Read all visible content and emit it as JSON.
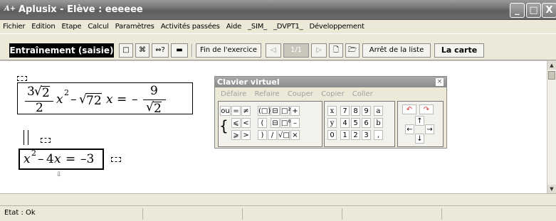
{
  "window": {
    "icon_text": "A+",
    "title": "Aplusix - Elève : eeeeee",
    "controls": {
      "minimize": "_",
      "maximize": "□",
      "close": "X"
    }
  },
  "menu": {
    "items": [
      "Fichier",
      "Edition",
      "Etape",
      "Calcul",
      "Paramètres",
      "Activités passées",
      "Aide",
      "_SIM_",
      "_DVPT1_",
      "Développement"
    ]
  },
  "toolbar": {
    "mode_label": "Entraînement (saisie)",
    "end_exercise": "Fin de l'exercice",
    "page_indicator": "1/1",
    "stop_list": "Arrêt de la liste",
    "card_label": "La carte",
    "icons": {
      "rect": "□",
      "grid": "⌘",
      "equiv": "⇔?",
      "keyboard": "▬",
      "prev": "◁",
      "next": "▷",
      "new": "🗋",
      "open": "🗁"
    }
  },
  "equation1": {
    "frac_num_coef": "3",
    "frac_num_rad": "2",
    "frac_den": "2",
    "x": "x",
    "sq": "2",
    "minus": "–",
    "rad2": "72",
    "x2": "x",
    "eq": "=",
    "neg": "–",
    "rhs_num": "9",
    "rhs_den_rad": "2"
  },
  "equation2": {
    "x": "x",
    "sq": "2",
    "minus": "–",
    "four": "4",
    "x2": "x",
    "eq": "=",
    "rhs": "–3"
  },
  "virtual_keyboard": {
    "title": "Clavier virtuel",
    "close": "×",
    "menu": [
      "Défaire",
      "Refaire",
      "Couper",
      "Copier",
      "Coller"
    ],
    "keys_left": [
      "ou",
      "=",
      "≠",
      "(□)",
      "⊟",
      "□²",
      "+",
      "⩽",
      "<",
      "(",
      "⊟",
      "□⁰",
      "–",
      "⩾",
      ">",
      ")",
      "/",
      "√□",
      "×"
    ],
    "brace": "{",
    "keys_mid": [
      "x",
      "7",
      "8",
      "9",
      "a",
      "y",
      "4",
      "5",
      "6",
      "b",
      "0",
      "1",
      "2",
      "3",
      ","
    ],
    "keys_right": [
      "↶",
      "↷",
      "↑",
      "←",
      "→",
      "↓"
    ]
  },
  "status": {
    "text": "Etat : Ok"
  }
}
